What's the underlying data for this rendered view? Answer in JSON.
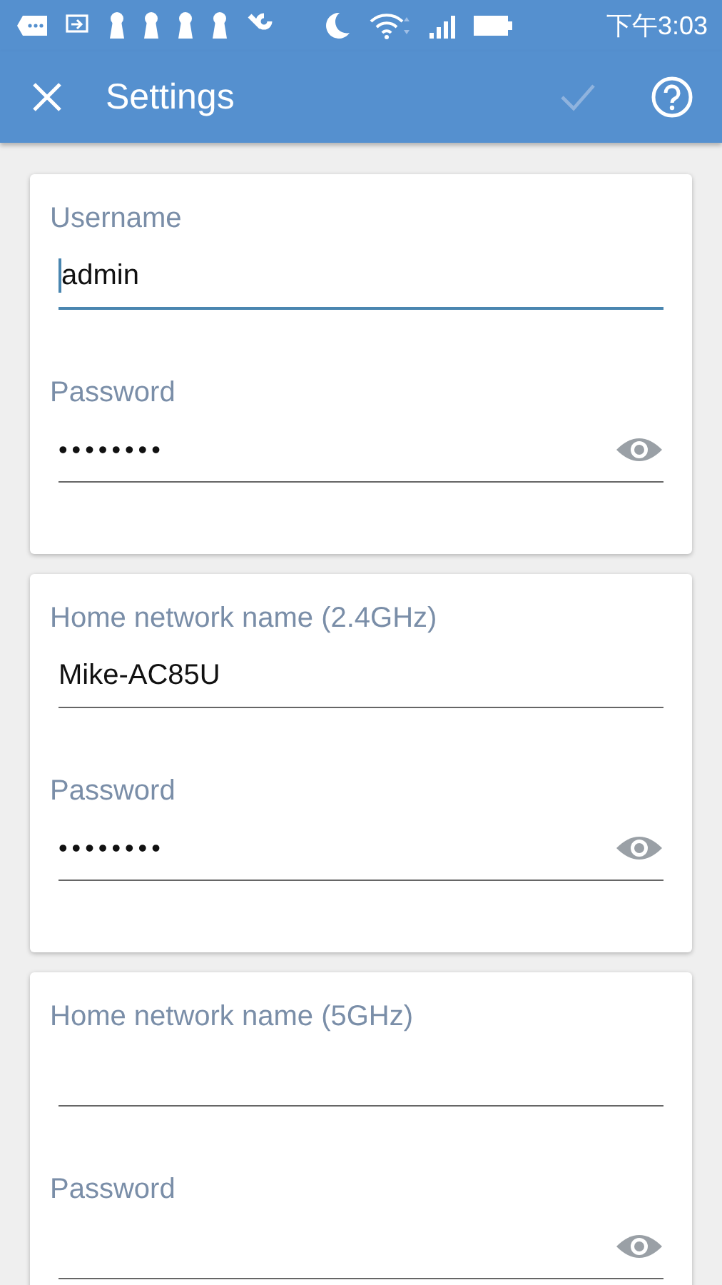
{
  "status_bar": {
    "time": "下午3:03"
  },
  "app_bar": {
    "title": "Settings",
    "done_enabled": false
  },
  "cards": [
    {
      "fields": [
        {
          "label": "Username",
          "kind": "text",
          "value": "admin",
          "focused": true
        },
        {
          "label": "Password",
          "kind": "password",
          "value": "••••••••",
          "focused": false
        }
      ]
    },
    {
      "fields": [
        {
          "label": "Home network name (2.4GHz)",
          "kind": "text",
          "value": "Mike-AC85U",
          "focused": false
        },
        {
          "label": "Password",
          "kind": "password",
          "value": "••••••••",
          "focused": false
        }
      ]
    },
    {
      "fields": [
        {
          "label": "Home network name (5GHz)",
          "kind": "text",
          "focused": false
        },
        {
          "label": "Password",
          "kind": "password",
          "focused": false
        }
      ]
    }
  ]
}
